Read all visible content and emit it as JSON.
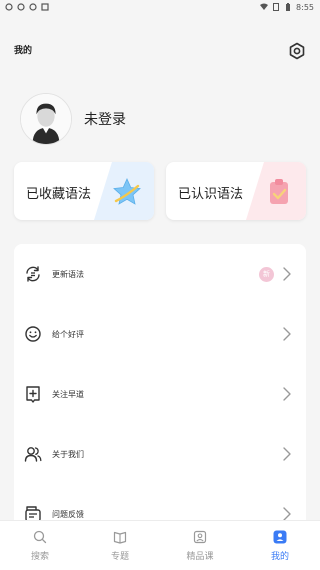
{
  "status_bar": {
    "time": "8:55",
    "icons": [
      "notification-icon",
      "notification-icon",
      "notification-icon",
      "app-icon",
      "wifi-icon",
      "sim-icon",
      "battery-icon"
    ]
  },
  "header": {
    "title": "我的",
    "settings_icon": "settings-hexagon-icon"
  },
  "profile": {
    "login_text": "未登录",
    "avatar_icon": "default-avatar-icon"
  },
  "cards": {
    "favorites_label": "已收藏语法",
    "favorites_icon": "star-icon",
    "learned_label": "已认识语法",
    "learned_icon": "clipboard-check-icon"
  },
  "menu": {
    "items": [
      {
        "label": "更新语法",
        "icon": "refresh-icon",
        "badge": "新"
      },
      {
        "label": "给个好评",
        "icon": "smile-icon"
      },
      {
        "label": "关注早道",
        "icon": "add-bookmark-icon"
      },
      {
        "label": "关于我们",
        "icon": "people-icon"
      },
      {
        "label": "问题反馈",
        "icon": "feedback-icon"
      }
    ]
  },
  "tabs": [
    {
      "label": "搜索",
      "icon": "search-icon"
    },
    {
      "label": "专题",
      "icon": "book-icon"
    },
    {
      "label": "精品课",
      "icon": "course-icon"
    },
    {
      "label": "我的",
      "icon": "profile-icon",
      "active": true
    }
  ],
  "colors": {
    "accent": "#3a7bf5",
    "background": "#f5f5f5",
    "card_blue_tint": "#e3f0ff",
    "card_pink_tint": "#fde7ea",
    "badge_pink": "#f3c6d6"
  }
}
